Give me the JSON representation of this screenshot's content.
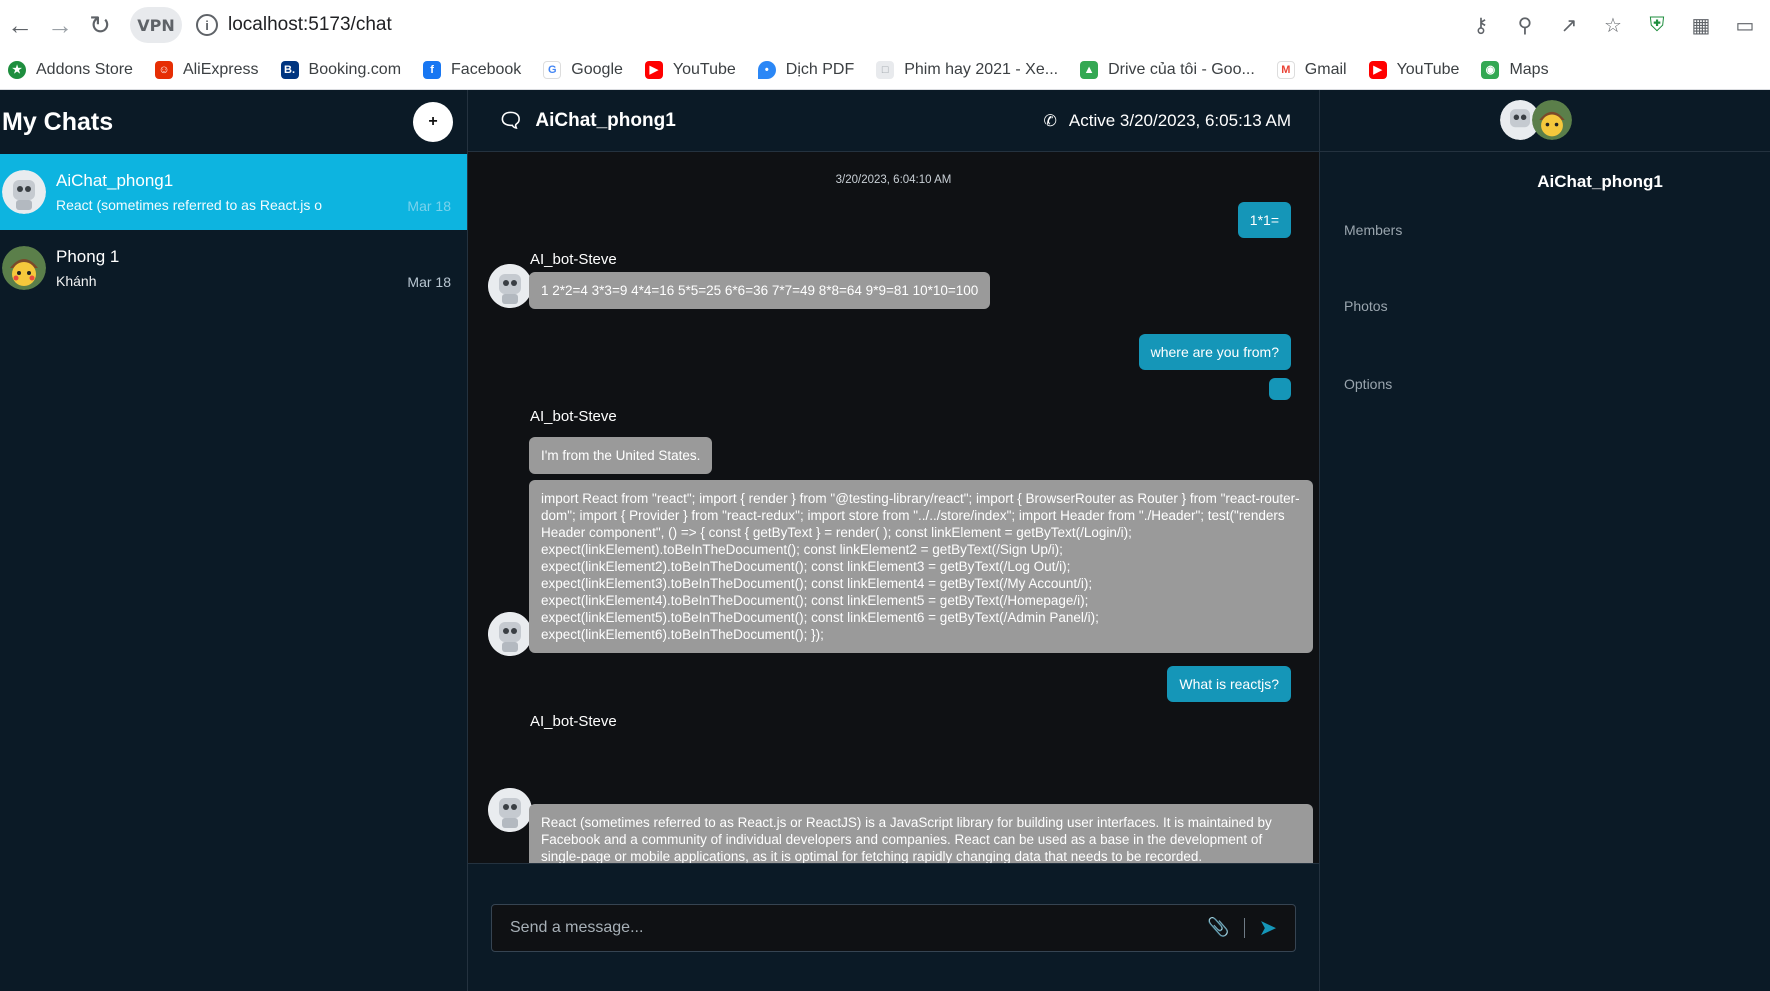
{
  "browser": {
    "vpn_label": "VPN",
    "url": "localhost:5173/chat"
  },
  "bookmarks": [
    {
      "label": "Addons Store",
      "color": "#1e8e3e"
    },
    {
      "label": "AliExpress",
      "color": "#e62e04"
    },
    {
      "label": "Booking.com",
      "color": "#003580"
    },
    {
      "label": "Facebook",
      "color": "#1877f2"
    },
    {
      "label": "Google",
      "color": "#4285f4"
    },
    {
      "label": "YouTube",
      "color": "#ff0000"
    },
    {
      "label": "Dịch PDF",
      "color": "#2b87f6"
    },
    {
      "label": "Phim hay 2021 - Xe...",
      "color": "#9aa0a6"
    },
    {
      "label": "Drive của tôi - Goo...",
      "color": "#34a853"
    },
    {
      "label": "Gmail",
      "color": "#ea4335"
    },
    {
      "label": "YouTube",
      "color": "#ff0000"
    },
    {
      "label": "Maps",
      "color": "#34a853"
    }
  ],
  "sidebar": {
    "title": "My Chats",
    "add_label": "+",
    "chats": [
      {
        "name": "AiChat_phong1",
        "preview": "React (sometimes referred to as React.js o",
        "date": "Mar 18"
      },
      {
        "name": "Phong 1",
        "preview": "Khánh",
        "date": "Mar 18"
      }
    ]
  },
  "header": {
    "chat_title": "AiChat_phong1",
    "status": "Active 3/20/2023, 6:05:13 AM"
  },
  "messages": {
    "timestamp": "3/20/2023, 6:04:10 AM",
    "me1": "1*1=",
    "bot_name": "AI_bot-Steve",
    "bot1": "1 2*2=4 3*3=9 4*4=16 5*5=25 6*6=36 7*7=49 8*8=64 9*9=81 10*10=100",
    "me2": "where are you from?",
    "bot2": "I'm from the United States.",
    "bot3": "import React from \"react\"; import { render } from \"@testing-library/react\"; import { BrowserRouter as Router } from \"react-router-dom\"; import { Provider } from \"react-redux\"; import store from \"../../store/index\"; import Header from \"./Header\"; test(\"renders Header component\", () => { const { getByText } = render( ); const linkElement = getByText(/Login/i); expect(linkElement).toBeInTheDocument(); const linkElement2 = getByText(/Sign Up/i); expect(linkElement2).toBeInTheDocument(); const linkElement3 = getByText(/Log Out/i); expect(linkElement3).toBeInTheDocument(); const linkElement4 = getByText(/My Account/i); expect(linkElement4).toBeInTheDocument(); const linkElement5 = getByText(/Homepage/i); expect(linkElement5).toBeInTheDocument(); const linkElement6 = getByText(/Admin Panel/i); expect(linkElement6).toBeInTheDocument(); });",
    "me3": "What is reactjs?",
    "bot4": "React (sometimes referred to as React.js or ReactJS) is a JavaScript library for building user interfaces. It is maintained by Facebook and a community of individual developers and companies. React can be used as a base in the development of single-page or mobile applications, as it is optimal for fetching rapidly changing data that needs to be recorded."
  },
  "composer": {
    "placeholder": "Send a message..."
  },
  "info": {
    "name": "AiChat_phong1",
    "members_label": "Members",
    "photos_label": "Photos",
    "options_label": "Options"
  },
  "colors": {
    "accent": "#0db4e0",
    "bubble_me": "#1596b8",
    "bubble_bot": "#9a9a9a",
    "background": "#0b1a26"
  }
}
